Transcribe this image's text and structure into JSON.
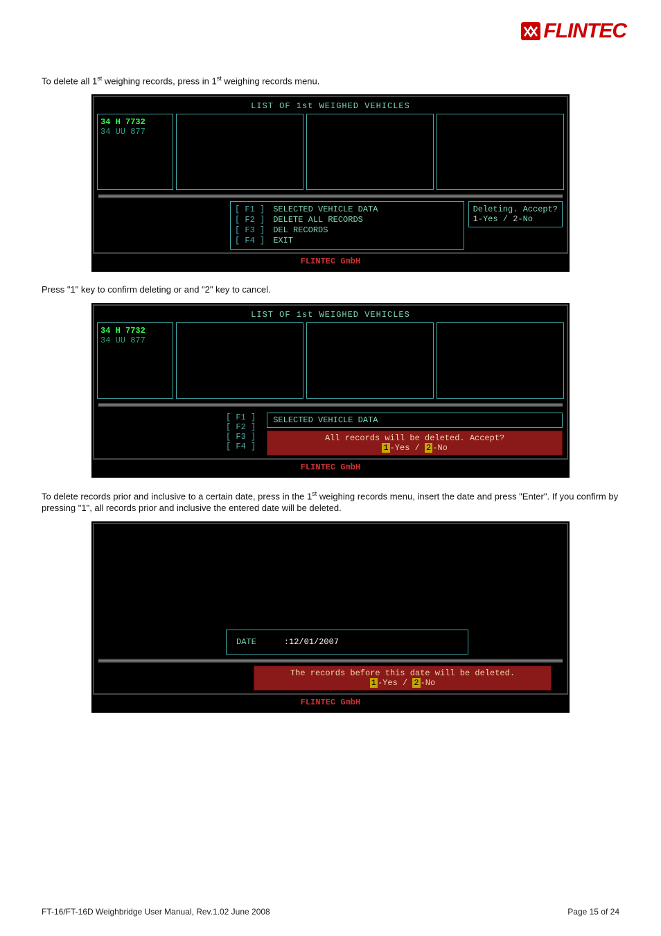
{
  "logo_text": "FLINTEC",
  "para1_pre": "To delete all 1",
  "para1_sup": "st",
  "para1_mid": " weighing records, press          in 1",
  "para1_end": " weighing records menu.",
  "term1": {
    "title": "LIST OF 1st WEIGHED VEHICLES",
    "plate1": "34 H 7732",
    "plate2": "34 UU 877",
    "fkeys": "[ F1 ]\n[ F2 ]\n[ F3 ]\n[ F4 ]",
    "actions": "SELECTED VEHICLE DATA\nDELETE ALL RECORDS\nDEL RECORDS\nEXIT",
    "confirm_l1": "Deleting. Accept?",
    "confirm_l2_a": "1",
    "confirm_l2_b": "-Yes / ",
    "confirm_l2_c": "2",
    "confirm_l2_d": "-No",
    "brand": "FLINTEC GmbH"
  },
  "para2": "Press \"1\" key to confirm deleting or and \"2\" key to cancel.",
  "term2": {
    "title": "LIST OF 1st WEIGHED VEHICLES",
    "plate1": "34 H 7732",
    "plate2": "34 UU 877",
    "fkeys": "[ F1 ]\n[ F2 ]\n[ F3 ]\n[ F4 ]",
    "action_top": "SELECTED VEHICLE DATA",
    "red_msg_a": "All records will be deleted. Accept?",
    "red_yes_n": "1",
    "red_yes_t": "-Yes / ",
    "red_no_n": "2",
    "red_no_t": "-No",
    "brand": "FLINTEC GmbH"
  },
  "para3_a": "To delete records prior and inclusive to a certain date, press          in the 1",
  "para3_sup": "st",
  "para3_b": " weighing records menu, insert the date and press \"Enter\". If you confirm by pressing \"1\", all records prior and inclusive the entered date will be deleted.",
  "term3": {
    "date_label": "DATE",
    "date_value": ":12/01/2007",
    "red_msg": "The records before this date will be deleted.",
    "red_yes_n": "1",
    "red_yes_t": "-Yes / ",
    "red_no_n": "2",
    "red_no_t": "-No",
    "brand": "FLINTEC GmbH"
  },
  "footer_left": "FT-16/FT-16D Weighbridge User Manual, Rev.1.02    June 2008",
  "footer_right": "Page 15 of 24"
}
